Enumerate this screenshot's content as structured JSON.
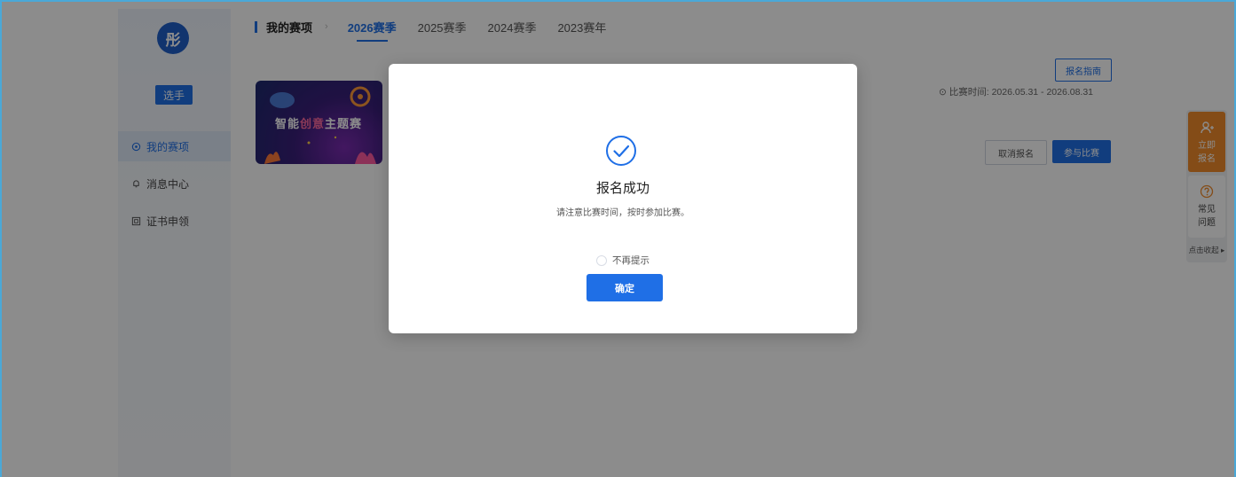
{
  "sidebar": {
    "avatar_text": "彤",
    "role_label": "选手",
    "items": [
      {
        "label": "我的赛项",
        "icon": "trophy-icon"
      },
      {
        "label": "消息中心",
        "icon": "bell-icon"
      },
      {
        "label": "证书申领",
        "icon": "certificate-icon"
      }
    ]
  },
  "header": {
    "title": "我的赛项",
    "tabs": [
      "2026赛季",
      "2025赛季",
      "2024赛季",
      "2023赛年"
    ]
  },
  "competition": {
    "image_title_a": "智能",
    "image_title_highlight": "创意",
    "image_title_b": "主题赛",
    "guide_button": "报名指南",
    "time_label": "比赛时间:",
    "time_range": "2026.05.31 - 2026.08.31",
    "cancel_button": "取消报名",
    "join_button": "参与比赛"
  },
  "float_widget": {
    "signup_label_1": "立即",
    "signup_label_2": "报名",
    "faq_label_1": "常见",
    "faq_label_2": "问题",
    "collapse_label": "点击收起",
    "signup_color": "#f08a2a"
  },
  "modal": {
    "title": "报名成功",
    "message": "请注意比赛时间，按时参加比赛。",
    "dont_show_label": "不再提示",
    "confirm_label": "确定"
  },
  "colors": {
    "accent": "#1f6fe6",
    "frame": "#4aa8d8"
  }
}
